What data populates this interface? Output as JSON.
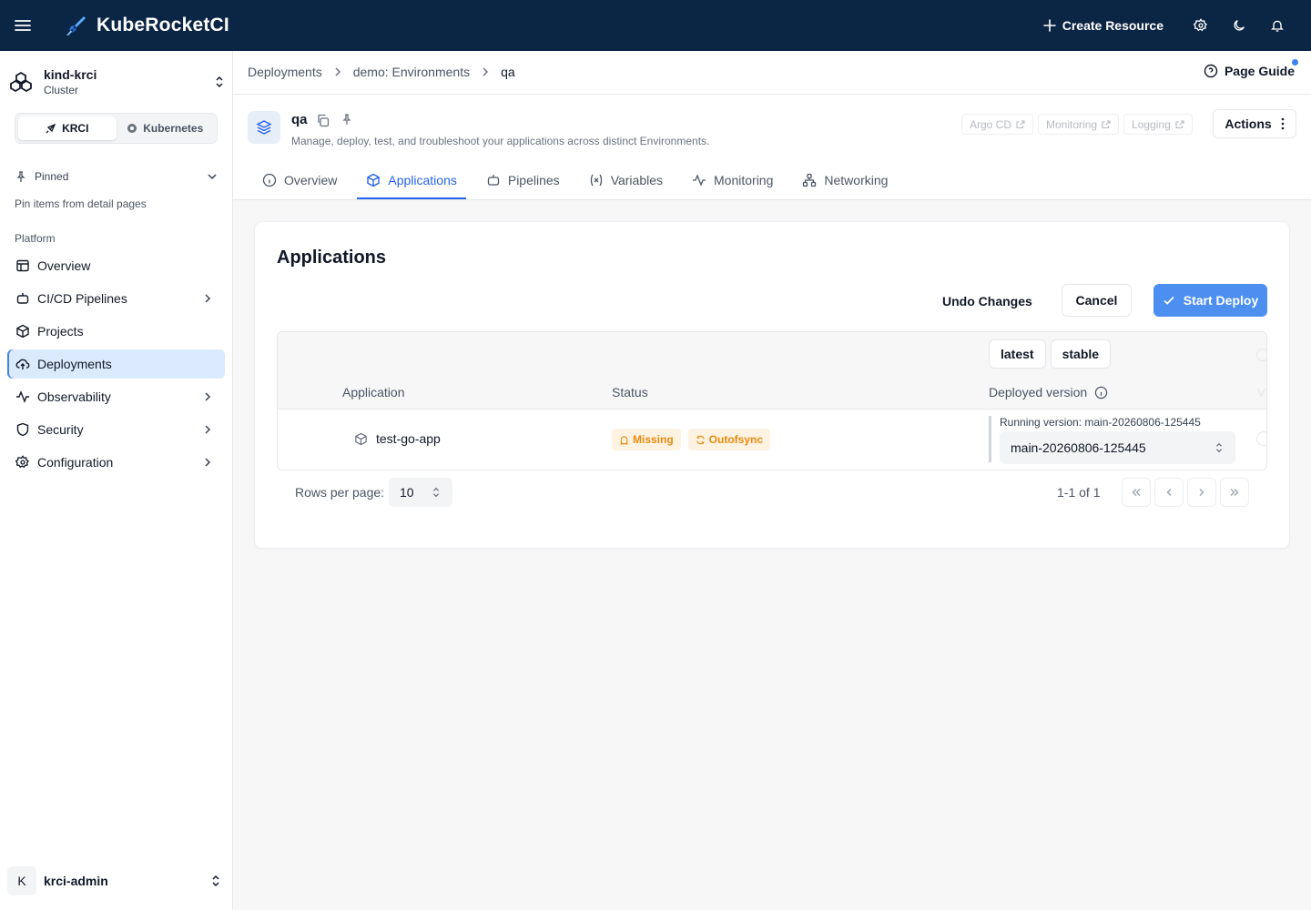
{
  "topbar": {
    "brand": "KubeRocketCI",
    "create_label": "Create Resource"
  },
  "sidebar": {
    "cluster_name": "kind-krci",
    "cluster_sub": "Cluster",
    "modes": [
      {
        "label": "KRCI",
        "active": true
      },
      {
        "label": "Kubernetes",
        "active": false
      }
    ],
    "pinned_label": "Pinned",
    "pinned_hint": "Pin items from detail pages",
    "section_label": "Platform",
    "items": [
      {
        "label": "Overview",
        "icon": "table-icon"
      },
      {
        "label": "CI/CD Pipelines",
        "icon": "bot-icon"
      },
      {
        "label": "Projects",
        "icon": "box-icon"
      },
      {
        "label": "Deployments",
        "icon": "cloud-upload-icon"
      },
      {
        "label": "Observability",
        "icon": "activity-icon"
      },
      {
        "label": "Security",
        "icon": "shield-icon"
      },
      {
        "label": "Configuration",
        "icon": "gear-icon"
      }
    ],
    "user_initial": "K",
    "user_name": "krci-admin"
  },
  "breadcrumb": {
    "items": [
      "Deployments",
      "demo: Environments",
      "qa"
    ],
    "guide_label": "Page Guide"
  },
  "page": {
    "title": "qa",
    "description": "Manage, deploy, test, and troubleshoot your applications across distinct Environments.",
    "ext_links": [
      "Argo CD",
      "Monitoring",
      "Logging"
    ],
    "actions_label": "Actions",
    "tabs": [
      {
        "label": "Overview",
        "active": false
      },
      {
        "label": "Applications",
        "active": true
      },
      {
        "label": "Pipelines",
        "active": false
      },
      {
        "label": "Variables",
        "active": false
      },
      {
        "label": "Monitoring",
        "active": false
      },
      {
        "label": "Networking",
        "active": false
      }
    ]
  },
  "card": {
    "title": "Applications",
    "undo_label": "Undo Changes",
    "cancel_label": "Cancel",
    "deploy_label": "Start Deploy",
    "version_tabs": [
      "latest",
      "stable"
    ],
    "columns": [
      "Application",
      "Status",
      "Deployed version"
    ],
    "rows": [
      {
        "app": "test-go-app",
        "badges": [
          "Missing",
          "Outofsync"
        ],
        "running_version": "Running version: main-20260806-125445",
        "selected_version": "main-20260806-125445"
      }
    ],
    "rows_per_page_label": "Rows per page:",
    "rows_per_page": "10",
    "pager_info": "1-1 of 1"
  },
  "colors": {
    "topbar": "#0b2545",
    "accent": "#2563eb",
    "primary_button": "#4d8ff0",
    "warning": "#ea8a0b"
  }
}
